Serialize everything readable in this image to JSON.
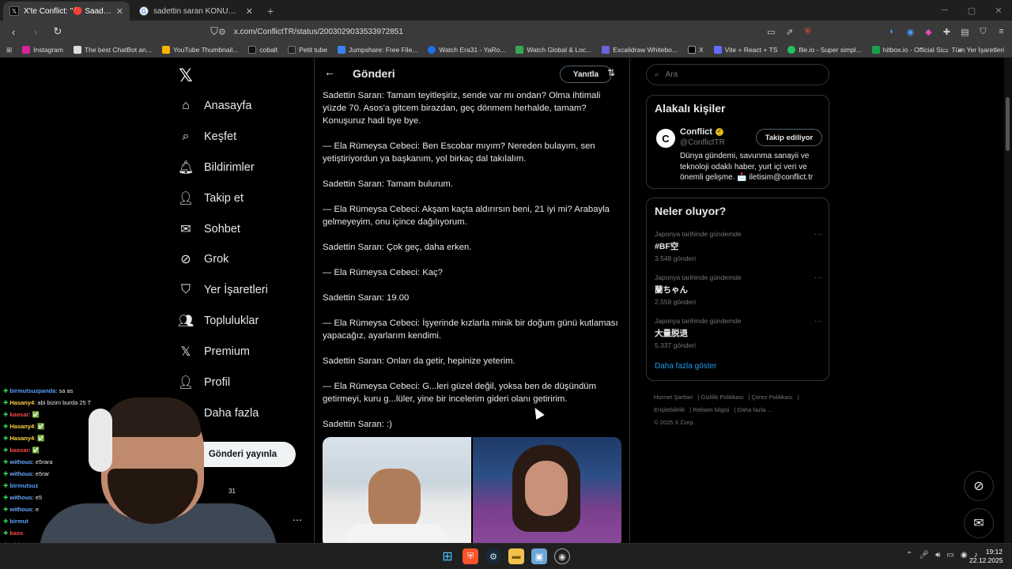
{
  "browser": {
    "tabs": [
      {
        "label": "X'te Conflict: \"🔴 Saadettin Saran",
        "active": true,
        "icon": "x-icon"
      },
      {
        "label": "sadettin saran KONUSMA - Google S",
        "active": false,
        "icon": "google-icon"
      }
    ],
    "url": "x.com/ConflictTR/status/2003029033533972851",
    "bookmarks": [
      "Instagram",
      "The best ChatBot an...",
      "YouTube Thumbnail...",
      "cobalt",
      "Petit tube",
      "Jumpshare: Free File...",
      "Watch Era31 - YaRo...",
      "Watch Global & Loc...",
      "Excalidraw Whitebo...",
      "X",
      "Vite + React + TS",
      "file.io - Super simpl...",
      "hitbox.io - Official Si..."
    ],
    "bookmarks_folder": "Tüm Yer İşaretleri"
  },
  "nav": {
    "items": [
      {
        "label": "Anasayfa",
        "icon": "home-icon"
      },
      {
        "label": "Keşfet",
        "icon": "search-icon"
      },
      {
        "label": "Bildirimler",
        "icon": "bell-icon"
      },
      {
        "label": "Takip et",
        "icon": "follow-icon"
      },
      {
        "label": "Sohbet",
        "icon": "mail-icon"
      },
      {
        "label": "Grok",
        "icon": "grok-icon"
      },
      {
        "label": "Yer İşaretleri",
        "icon": "bookmark-icon"
      },
      {
        "label": "Topluluklar",
        "icon": "communities-icon"
      },
      {
        "label": "Premium",
        "icon": "x-icon"
      },
      {
        "label": "Profil",
        "icon": "profile-icon"
      },
      {
        "label": "Daha fazla",
        "icon": "more-icon"
      }
    ],
    "post_button": "Gönderi yayınla",
    "partial_text": "31"
  },
  "main": {
    "title": "Gönderi",
    "reply_button": "Yanıtla",
    "paragraphs": [
      "Sadettin Saran: Tamam teyitleşiriz, sende var mı ondan? Olma ihtimali yüzde 70. Asos'a gitcem birazdan, geç dönmem herhalde, tamam? Konuşuruz hadi bye bye.",
      "— Ela Rümeysa Cebeci: Ben Escobar mıyım? Nereden bulayım, sen yetiştiriyordun ya başkanım, yol birkaç dal takılalım.",
      "Sadettin Saran: Tamam bulurum.",
      "— Ela Rümeysa Cebeci: Akşam kaçta aldırırsın beni, 21 iyi mi? Arabayla gelmeyeyim, onu içince dağılıyorum.",
      "Sadettin Saran: Çok geç, daha erken.",
      "— Ela Rümeysa Cebeci: Kaç?",
      "Sadettin Saran: 19.00",
      "— Ela Rümeysa Cebeci: İşyerinde kızlarla minik bir doğum günü kutlaması yapacağız, ayarlarım kendimi.",
      "Sadettin Saran: Onları da getir, hepinize yeterim.",
      "— Ela Rümeysa Cebeci: G...leri güzel değil, yoksa ben de düşündüm getirmeyi, kuru g...lüler, yine bir incelerim gideri olanı getiririm.",
      "Sadettin Saran: :)"
    ]
  },
  "right": {
    "search_placeholder": "Ara",
    "related_title": "Alakalı kişiler",
    "person": {
      "name": "Conflict",
      "handle": "@ConflictTR",
      "follow_label": "Takip ediliyor",
      "bio": "Dünya gündemi, savunma sanayii ve teknoloji odaklı haber, yurt içi veri ve önemli gelişme. 📩 iletisim@conflict.tr"
    },
    "trends_title": "Neler oluyor?",
    "trends": [
      {
        "context": "Japonya tarihinde gündemde",
        "title": "#BF空",
        "count": "3.548 gönderi"
      },
      {
        "context": "Japonya tarihinde gündemde",
        "title": "蘭ちゃん",
        "count": "2.559 gönderi"
      },
      {
        "context": "Japonya tarihinde gündemde",
        "title": "大量脱退",
        "count": "5.337 gönderi"
      }
    ],
    "show_more": "Daha fazla göster",
    "footer_links": [
      "Hizmet Şartları",
      "Gizlilik Politikası",
      "Çerez Politikası",
      "Erişilebilirlik",
      "Reklam bilgisi",
      "Daha fazla ..."
    ],
    "copyright": "© 2025 X Corp."
  },
  "chat": [
    {
      "user": "birmutsuzpanda",
      "msg": ": sa as",
      "color": "#5aa0ff"
    },
    {
      "user": "Hasany4",
      "msg": ": abi bizim burda 25 T",
      "color": "#ffd23d"
    },
    {
      "user": "kaosar",
      "msg": ": ✅",
      "color": "#ff4a4a"
    },
    {
      "user": "Hasany4",
      "msg": ": ✅",
      "color": "#ffd23d"
    },
    {
      "user": "Hasany4",
      "msg": ": ✅",
      "color": "#ffd23d"
    },
    {
      "user": "kaosar",
      "msg": ": ✅",
      "color": "#ff4a4a"
    },
    {
      "user": "withous",
      "msg": ": e5rara",
      "color": "#6aa8ff"
    },
    {
      "user": "withous",
      "msg": ": e5rar",
      "color": "#6aa8ff"
    },
    {
      "user": "birmutsuz",
      "msg": "",
      "color": "#5aa0ff"
    },
    {
      "user": "withous",
      "msg": ": e5",
      "color": "#6aa8ff"
    },
    {
      "user": "withous",
      "msg": ": e",
      "color": "#6aa8ff"
    },
    {
      "user": "birmut",
      "msg": "",
      "color": "#5aa0ff"
    },
    {
      "user": "kaos",
      "msg": "",
      "color": "#ff4a4a"
    },
    {
      "user": "with",
      "msg": "",
      "color": "#6aa8ff"
    },
    {
      "user": "ka",
      "msg": "",
      "color": "#ff4a4a"
    }
  ],
  "taskbar": {
    "time": "19:12",
    "date": "22.12.2025"
  }
}
